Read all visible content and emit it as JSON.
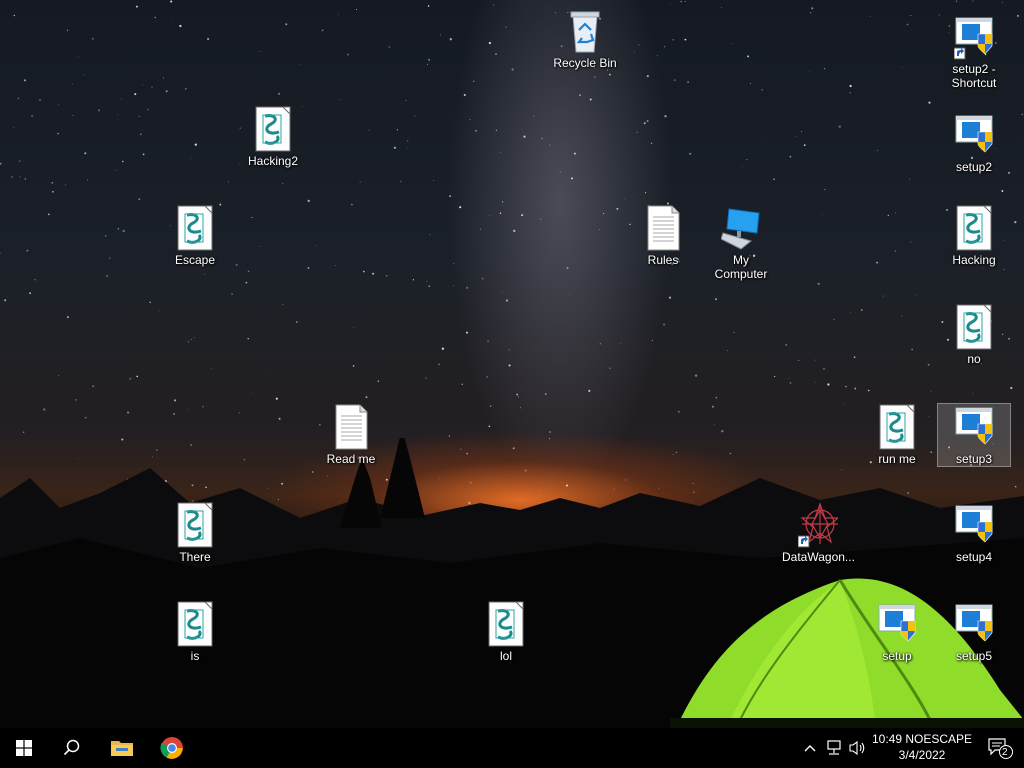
{
  "desktop": {
    "icons": [
      {
        "label": "Recycle Bin",
        "type": "recycle-bin"
      },
      {
        "label": "setup2 - Shortcut",
        "type": "setup-shortcut"
      },
      {
        "label": "Hacking2",
        "type": "script"
      },
      {
        "label": "setup2",
        "type": "setup"
      },
      {
        "label": "Escape",
        "type": "script"
      },
      {
        "label": "Rules",
        "type": "text"
      },
      {
        "label": "My Computer",
        "type": "computer"
      },
      {
        "label": "Hacking",
        "type": "script"
      },
      {
        "label": "no",
        "type": "script"
      },
      {
        "label": "Read me",
        "type": "text"
      },
      {
        "label": "run me",
        "type": "script"
      },
      {
        "label": "setup3",
        "type": "setup",
        "selected": true
      },
      {
        "label": "There",
        "type": "script"
      },
      {
        "label": "DataWagon...",
        "type": "app-shortcut"
      },
      {
        "label": "setup4",
        "type": "setup"
      },
      {
        "label": "is",
        "type": "script"
      },
      {
        "label": "lol",
        "type": "script"
      },
      {
        "label": "setup",
        "type": "setup"
      },
      {
        "label": "setup5",
        "type": "setup"
      }
    ]
  },
  "taskbar": {
    "start_icon": "windows-logo-icon",
    "search_icon": "search-icon",
    "pinned": [
      {
        "name": "File Explorer",
        "icon": "folder-icon"
      },
      {
        "name": "Google Chrome",
        "icon": "chrome-icon"
      }
    ],
    "tray": {
      "chevron_icon": "chevron-up-icon",
      "network_icon": "network-icon",
      "volume_icon": "volume-icon",
      "clock_time": "10:49 NOESCAPE",
      "clock_date": "3/4/2022",
      "notification_count": "2"
    }
  },
  "colors": {
    "taskbar": "#000000",
    "selection": "#ffffff2e",
    "tent": "#7ed321",
    "horizon": "#ff7a28"
  }
}
